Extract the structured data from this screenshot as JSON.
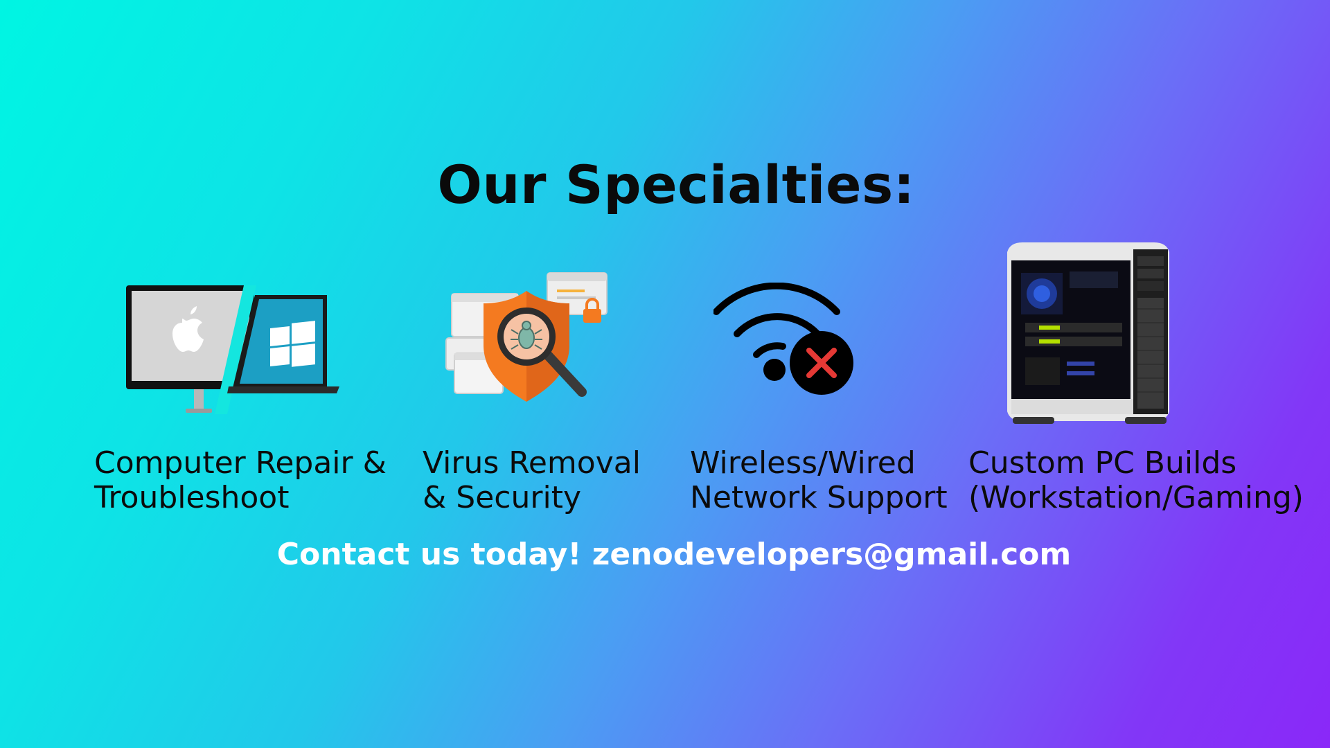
{
  "slide": {
    "title": "Our Specialties:",
    "contact": "Contact us today! zenodevelopers@gmail.com"
  },
  "specialties": [
    {
      "line1": "Computer Repair &",
      "line2": "Troubleshoot",
      "icon": "mac-windows-devices-icon"
    },
    {
      "line1": "Virus Removal",
      "line2": "& Security",
      "icon": "shield-bug-magnifier-icon"
    },
    {
      "line1": "Wireless/Wired",
      "line2": "Network Support",
      "icon": "wifi-disconnected-icon"
    },
    {
      "line1": "Custom PC Builds",
      "line2": "(Workstation/Gaming)",
      "icon": "pc-tower-icon"
    }
  ],
  "colors": {
    "gradient_start": "#00f5e3",
    "gradient_end": "#8a28f8",
    "shield_orange": "#f47a20",
    "error_red": "#e53935",
    "windows_teal": "#1c9fc4"
  }
}
